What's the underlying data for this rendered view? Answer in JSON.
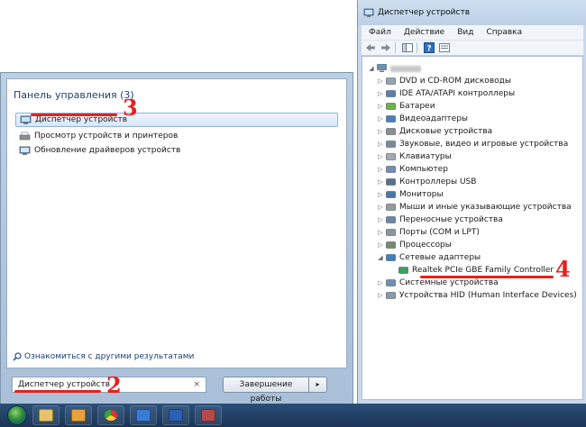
{
  "start_menu": {
    "header": "Панель управления (3)",
    "items": [
      {
        "label": "Диспетчер устройств",
        "icon": "device-manager-icon",
        "selected": true
      },
      {
        "label": "Просмотр устройств и принтеров",
        "icon": "printers-icon",
        "selected": false
      },
      {
        "label": "Обновление драйверов устройств",
        "icon": "update-drivers-icon",
        "selected": false
      }
    ],
    "more_results": "Ознакомиться с другими результатами",
    "search_value": "Диспетчер устройств",
    "search_clear": "×",
    "shutdown_label": "Завершение работы",
    "shutdown_arrow": "▸"
  },
  "device_manager": {
    "title": "Диспетчер устройств",
    "menu": [
      "Файл",
      "Действие",
      "Вид",
      "Справка"
    ],
    "tree": [
      {
        "label": "DVD и CD-ROM дисководы",
        "icon": "dvd-drive-icon"
      },
      {
        "label": "IDE ATA/ATAPI контроллеры",
        "icon": "ide-controller-icon"
      },
      {
        "label": "Батареи",
        "icon": "battery-icon"
      },
      {
        "label": "Видеоадаптеры",
        "icon": "display-adapter-icon"
      },
      {
        "label": "Дисковые устройства",
        "icon": "disk-drive-icon"
      },
      {
        "label": "Звуковые, видео и игровые устройства",
        "icon": "sound-icon"
      },
      {
        "label": "Клавиатуры",
        "icon": "keyboard-icon"
      },
      {
        "label": "Компьютер",
        "icon": "computer-icon"
      },
      {
        "label": "Контроллеры USB",
        "icon": "usb-icon"
      },
      {
        "label": "Мониторы",
        "icon": "monitor-icon"
      },
      {
        "label": "Мыши и иные указывающие устройства",
        "icon": "mouse-icon"
      },
      {
        "label": "Переносные устройства",
        "icon": "portable-device-icon"
      },
      {
        "label": "Порты (COM и LPT)",
        "icon": "port-icon"
      },
      {
        "label": "Процессоры",
        "icon": "processor-icon"
      },
      {
        "label": "Сетевые адаптеры",
        "icon": "network-adapter-icon",
        "expanded": true
      },
      {
        "label": "Realtek PCIe GBE Family Controller",
        "icon": "network-card-icon",
        "child": true
      },
      {
        "label": "Системные устройства",
        "icon": "system-device-icon"
      },
      {
        "label": "Устройства HID (Human Interface Devices)",
        "icon": "hid-icon"
      }
    ]
  },
  "annotations": [
    "2",
    "3",
    "4"
  ],
  "colors": {
    "accent_red": "#e8201c",
    "header_blue": "#1e3f72"
  }
}
